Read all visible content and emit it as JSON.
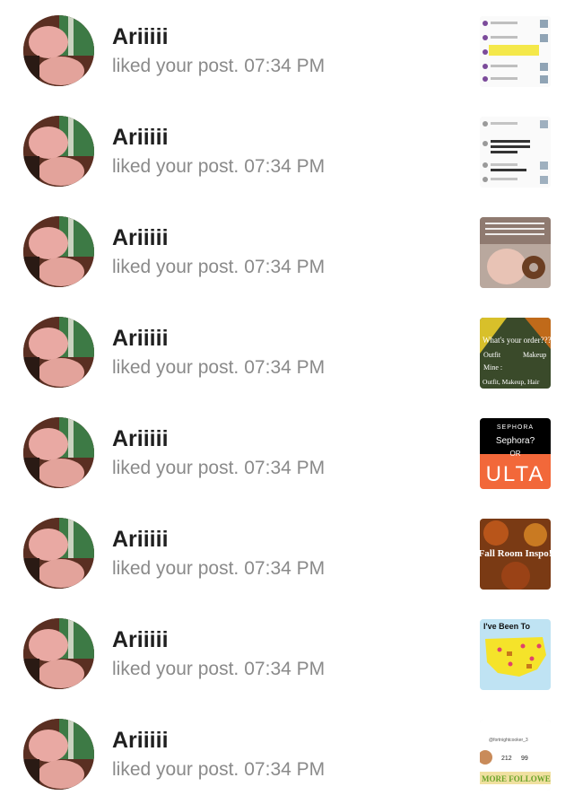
{
  "notifications": [
    {
      "user": "Ariiiii",
      "action": "liked your post.",
      "time": "07:34 PM",
      "thumbnail": "screenshot-list-purple",
      "thumb_text": ""
    },
    {
      "user": "Ariiiii",
      "action": "liked your post.",
      "time": "07:34 PM",
      "thumbnail": "screenshot-list-gray",
      "thumb_text": ""
    },
    {
      "user": "Ariiiii",
      "action": "liked your post.",
      "time": "07:34 PM",
      "thumbnail": "baby-donut-photo",
      "thumb_text": ""
    },
    {
      "user": "Ariiiii",
      "action": "liked your post.",
      "time": "07:34 PM",
      "thumbnail": "whats-your-order",
      "thumb_text": "What's your order???"
    },
    {
      "user": "Ariiiii",
      "action": "liked your post.",
      "time": "07:34 PM",
      "thumbnail": "sephora-or-ulta",
      "thumb_text": "Sephora?"
    },
    {
      "user": "Ariiiii",
      "action": "liked your post.",
      "time": "07:34 PM",
      "thumbnail": "fall-room-inspo",
      "thumb_text": "Fall Room Inspo!"
    },
    {
      "user": "Ariiiii",
      "action": "liked your post.",
      "time": "07:34 PM",
      "thumbnail": "ive-been-to-map",
      "thumb_text": "I've Been To"
    },
    {
      "user": "Ariiiii",
      "action": "liked your post.",
      "time": "07:34 PM",
      "thumbnail": "profile-stats",
      "thumb_text": ""
    }
  ],
  "thumb_labels": {
    "sephora": "SEPHORA",
    "or": "OR",
    "ulta": "ULTA",
    "outfit": "Outfit",
    "makeup": "Makeup",
    "mine": "Mine :",
    "outfit_makeup_hair": "Outfit, Makeup, Hair",
    "stat_a": "212",
    "stat_b": "99",
    "handle": "@fortnightcooker_3",
    "more_followers": "MORE FOLLOWERS"
  },
  "colors": {
    "name": "#1f1f1f",
    "meta": "#8a8a8a",
    "background": "#ffffff"
  }
}
